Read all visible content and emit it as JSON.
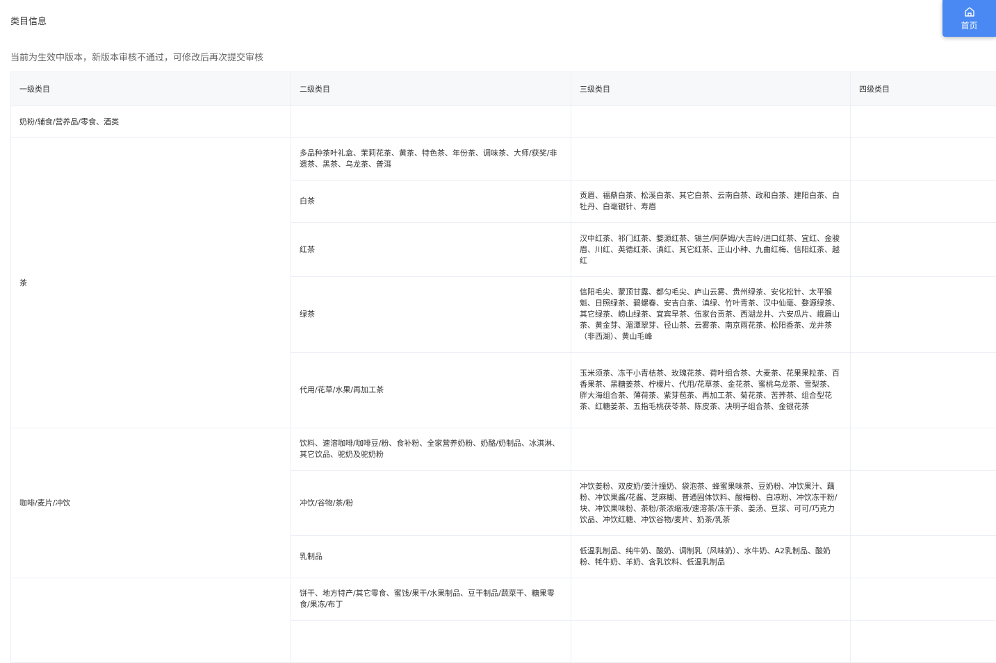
{
  "section_title": "类目信息",
  "notice": "当前为生效中版本，新版本审核不通过，可修改后再次提交审核",
  "home_button": {
    "label": "首页",
    "icon": "home-icon"
  },
  "table": {
    "headers": [
      "一级类目",
      "二级类目",
      "三级类目",
      "四级类目"
    ],
    "groups": [
      {
        "level1": "奶粉/辅食/营养品/零食、酒类",
        "rows": [
          {
            "level2": "",
            "level3": "",
            "level4": ""
          }
        ]
      },
      {
        "level1": "茶",
        "rows": [
          {
            "level2": "多品种茶叶礼盒、茉莉花茶、黄茶、特色茶、年份茶、调味茶、大师/获奖/非遗茶、黑茶、乌龙茶、普洱",
            "level3": "",
            "level4": ""
          },
          {
            "level2": "白茶",
            "level3": "贡眉、福鼎白茶、松溪白茶、其它白茶、云南白茶、政和白茶、建阳白茶、白牡丹、白毫银针、寿眉",
            "level4": ""
          },
          {
            "level2": "红茶",
            "level3": "汉中红茶、祁门红茶、婺源红茶、锡兰/阿萨姆/大吉岭/进口红茶、宜红、金骏眉、川红、英德红茶、滇红、其它红茶、正山小种、九曲红梅、信阳红茶、越红",
            "level4": ""
          },
          {
            "level2": "绿茶",
            "level3": "信阳毛尖、蒙顶甘露、都匀毛尖、庐山云雾、贵州绿茶、安化松针、太平猴魁、日照绿茶、碧螺春、安吉白茶、滇绿、竹叶青茶、汉中仙毫、婺源绿茶、其它绿茶、崂山绿茶、宜宾早茶、伍家台贡茶、西湖龙井、六安瓜片、峨眉山茶、黄金芽、湄潭翠芽、径山茶、云雾茶、南京雨花茶、松阳香茶、龙井茶（非西湖）、黄山毛峰",
            "level4": ""
          },
          {
            "level2": "代用/花草/水果/再加工茶",
            "level3": "玉米须茶、冻干小青桔茶、玫瑰花茶、荷叶组合茶、大麦茶、花果果粒茶、百香果茶、黑糖姜茶、柠檬片、代用/花草茶、金花茶、蜜桃乌龙茶、雪梨茶、胖大海组合茶、薄荷茶、紫芽苞茶、再加工茶、菊花茶、苦荞茶、组合型花茶、红糖姜茶、五指毛桃茯苓茶、陈皮茶、决明子组合茶、金银花茶",
            "level4": ""
          }
        ]
      },
      {
        "level1": "咖啡/麦片/冲饮",
        "rows": [
          {
            "level2": "饮料、速溶咖啡/咖啡豆/粉、食补粉、全家营养奶粉、奶酪/奶制品、冰淇淋、其它饮品、驼奶及驼奶粉",
            "level3": "",
            "level4": ""
          },
          {
            "level2": "冲饮/谷物/茶/粉",
            "level3": "冲饮姜粉、双皮奶/姜汁撞奶、袋泡茶、蜂蜜果味茶、豆奶粉、冲饮果汁、藕粉、冲饮果酱/花酱、芝麻糊、普通固体饮料、酸梅粉、白凉粉、冲饮冻干粉/块、冲饮果味粉、茶粉/茶浓缩液/速溶茶/冻干茶、姜汤、豆浆、可可/巧克力饮品、冲饮红糖、冲饮谷物/麦片、奶茶/乳茶",
            "level4": ""
          },
          {
            "level2": "乳制品",
            "level3": "低温乳制品、纯牛奶、酸奶、调制乳（风味奶）、水牛奶、A2乳制品、酸奶粉、牦牛奶、羊奶、含乳饮料、低温乳制品",
            "level4": ""
          }
        ]
      },
      {
        "level1": "",
        "rows": [
          {
            "level2": "饼干、地方特产/其它零食、蜜饯/果干/水果制品、豆干制品/蔬菜干、糖果零食/果冻/布丁",
            "level3": "",
            "level4": ""
          },
          {
            "level2": "",
            "level3": "",
            "level4": ""
          }
        ]
      }
    ]
  }
}
